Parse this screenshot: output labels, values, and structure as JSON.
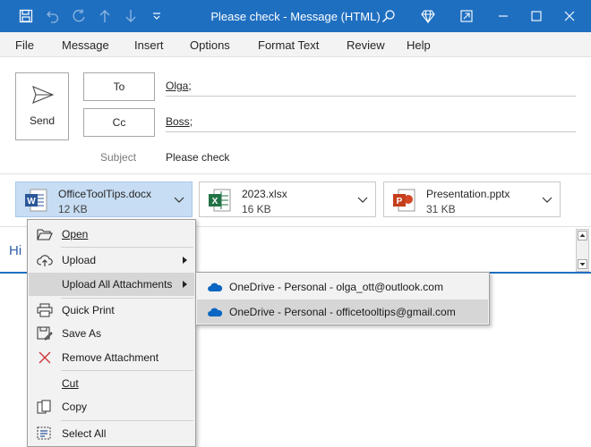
{
  "window": {
    "title": "Please check",
    "separator": " - ",
    "mode": "Message (HTML)",
    "accent": "#1f6fc1"
  },
  "title_icons": [
    "save-icon",
    "undo-icon",
    "redo-icon",
    "up-arrow-icon",
    "down-arrow-icon",
    "customize-quick-access-icon"
  ],
  "title_right_icons": [
    "search-icon",
    "diamond-icon",
    "restore-icon",
    "minimize-icon",
    "maximize-icon",
    "close-icon"
  ],
  "menu": [
    "File",
    "Message",
    "Insert",
    "Options",
    "Format Text",
    "Review",
    "Help"
  ],
  "compose": {
    "send_label": "Send",
    "to_label": "To",
    "cc_label": "Cc",
    "to_value": "Olga",
    "to_suffix": ";",
    "cc_value": "Boss",
    "cc_suffix": ";",
    "subject_label": "Subject",
    "subject_value": "Please check"
  },
  "attachments": [
    {
      "name": "OfficeToolTips.docx",
      "size": "12 KB",
      "icon": "word-icon",
      "selected": true
    },
    {
      "name": "2023.xlsx",
      "size": "16 KB",
      "icon": "excel-icon",
      "selected": false
    },
    {
      "name": "Presentation.pptx",
      "size": "31 KB",
      "icon": "powerpoint-icon",
      "selected": false
    }
  ],
  "body": {
    "text": "Hi"
  },
  "context_menu": {
    "items": [
      {
        "label": "Open",
        "icon": "open-folder-icon"
      },
      {
        "label": "Upload",
        "icon": "cloud-upload-icon"
      },
      {
        "label": "Upload All Attachments",
        "icon": ""
      },
      {
        "label": "Quick Print",
        "icon": "printer-icon"
      },
      {
        "label": "Save As",
        "icon": "save-as-icon"
      },
      {
        "label": "Remove Attachment",
        "icon": "remove-icon"
      },
      {
        "label": "Cut",
        "icon": ""
      },
      {
        "label": "Copy",
        "icon": "copy-icon"
      },
      {
        "label": "Select All",
        "icon": "select-all-icon"
      }
    ]
  },
  "submenu": {
    "items": [
      {
        "label": "OneDrive - Personal - olga_ott@outlook.com",
        "icon": "onedrive-icon"
      },
      {
        "label": "OneDrive - Personal - officetooltips@gmail.com",
        "icon": "onedrive-icon"
      }
    ]
  }
}
